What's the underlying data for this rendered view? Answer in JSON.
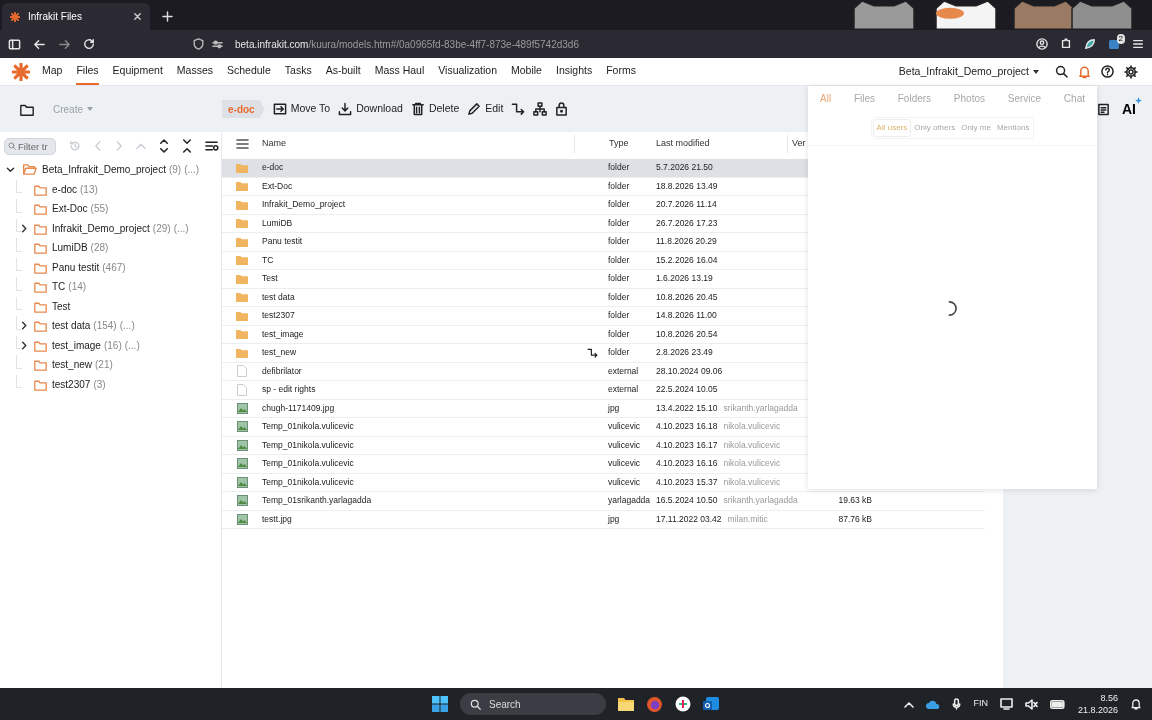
{
  "browser": {
    "tab_title": "Infrakit Files",
    "url_host": "beta.infrakit.com",
    "url_path": "/kuura/models.htm#/0a0965fd-83be-4ff7-873e-489f5742d3d6",
    "extension_badge": "2"
  },
  "nav": {
    "items": [
      {
        "label": "Map",
        "selected": false
      },
      {
        "label": "Files",
        "selected": true
      },
      {
        "label": "Equipment",
        "selected": false
      },
      {
        "label": "Masses",
        "selected": false
      },
      {
        "label": "Schedule",
        "selected": false
      },
      {
        "label": "Tasks",
        "selected": false
      },
      {
        "label": "As-built",
        "selected": false
      },
      {
        "label": "Mass Haul",
        "selected": false
      },
      {
        "label": "Visualization",
        "selected": false
      },
      {
        "label": "Mobile",
        "selected": false
      },
      {
        "label": "Insights",
        "selected": false
      },
      {
        "label": "Forms",
        "selected": false
      }
    ],
    "project": "Beta_Infrakit_Demo_project",
    "notifications_active": true
  },
  "toolbar": {
    "create": {
      "label": "Create",
      "disabled": true
    },
    "breadcrumb": "e-doc",
    "actions": [
      {
        "kind": "move",
        "label": "Move To"
      },
      {
        "kind": "download",
        "label": "Download"
      },
      {
        "kind": "delete",
        "label": "Delete"
      },
      {
        "kind": "edit",
        "label": "Edit"
      }
    ],
    "ai_label": "AI"
  },
  "tree": {
    "filter_placeholder": "Filter tr",
    "root": {
      "label": "Beta_Infrakit_Demo_project",
      "count": "(9)",
      "more": "(...)",
      "expanded": true,
      "children": [
        {
          "label": "e-doc",
          "count": "(13)",
          "expandable": false
        },
        {
          "label": "Ext-Doc",
          "count": "(55)",
          "expandable": false
        },
        {
          "label": "Infrakit_Demo_project",
          "count": "(29)",
          "more": "(...)",
          "expandable": true
        },
        {
          "label": "LumiDB",
          "count": "(28)",
          "expandable": false
        },
        {
          "label": "Panu testit",
          "count": "(467)",
          "expandable": false
        },
        {
          "label": "TC",
          "count": "(14)",
          "expandable": false
        },
        {
          "label": "Test",
          "expandable": false
        },
        {
          "label": "test data",
          "count": "(154)",
          "more": "(...)",
          "expandable": true
        },
        {
          "label": "test_image",
          "count": "(16)",
          "more": "(...)",
          "expandable": true
        },
        {
          "label": "test_new",
          "count": "(21)",
          "expandable": false
        },
        {
          "label": "test2307",
          "count": "(3)",
          "expandable": false
        }
      ]
    }
  },
  "table": {
    "columns": [
      "Name",
      "Type",
      "Last modified",
      "Ver"
    ],
    "rows": [
      {
        "kind": "folder",
        "name": "e-doc",
        "type": "folder",
        "modified": "5.7.2026 21.50",
        "selected": true,
        "shortcut": false
      },
      {
        "kind": "folder",
        "name": "Ext-Doc",
        "type": "folder",
        "modified": "18.8.2026 13.49",
        "selected": false,
        "shortcut": false
      },
      {
        "kind": "folder",
        "name": "Infrakit_Demo_project",
        "type": "folder",
        "modified": "20.7.2026 11.14",
        "selected": false,
        "shortcut": false
      },
      {
        "kind": "folder",
        "name": "LumiDB",
        "type": "folder",
        "modified": "26.7.2026 17.23",
        "selected": false,
        "shortcut": false
      },
      {
        "kind": "folder",
        "name": "Panu testit",
        "type": "folder",
        "modified": "11.8.2026 20.29",
        "selected": false,
        "shortcut": false
      },
      {
        "kind": "folder",
        "name": "TC",
        "type": "folder",
        "modified": "15.2.2026 16.04",
        "selected": false,
        "shortcut": false
      },
      {
        "kind": "folder",
        "name": "Test",
        "type": "folder",
        "modified": "1.6.2026 13.19",
        "selected": false,
        "shortcut": false
      },
      {
        "kind": "folder",
        "name": "test data",
        "type": "folder",
        "modified": "10.8.2026 20.45",
        "selected": false,
        "shortcut": false
      },
      {
        "kind": "folder",
        "name": "test2307",
        "type": "folder",
        "modified": "14.8.2026 11.00",
        "selected": false,
        "shortcut": false
      },
      {
        "kind": "folder",
        "name": "test_image",
        "type": "folder",
        "modified": "10.8.2026 20.54",
        "selected": false,
        "shortcut": false
      },
      {
        "kind": "folder",
        "name": "test_new",
        "type": "folder",
        "modified": "2.8.2026 23.49",
        "selected": false,
        "shortcut": true
      },
      {
        "kind": "file",
        "name": "defibrilator",
        "type": "external",
        "modified": "28.10.2024 09.06",
        "selected": false,
        "shortcut": false
      },
      {
        "kind": "file",
        "name": "sp - edit rights",
        "type": "external",
        "modified": "22.5.2024 10.05",
        "selected": false,
        "shortcut": false
      },
      {
        "kind": "image",
        "name": "chugh-1171409.jpg",
        "type": "jpg",
        "modified": "13.4.2022 15.10",
        "user": "srikanth.yarlagadda",
        "selected": false,
        "shortcut": false
      },
      {
        "kind": "image",
        "name": "Temp_01nikola.vulicevic",
        "type": "vulicevic",
        "modified": "4.10.2023 16.18",
        "user": "nikola.vulicevic",
        "selected": false,
        "shortcut": false
      },
      {
        "kind": "image",
        "name": "Temp_01nikola.vulicevic",
        "type": "vulicevic",
        "modified": "4.10.2023 16.17",
        "user": "nikola.vulicevic",
        "selected": false,
        "shortcut": false
      },
      {
        "kind": "image",
        "name": "Temp_01nikola.vulicevic",
        "type": "vulicevic",
        "modified": "4.10.2023 16.16",
        "user": "nikola.vulicevic",
        "selected": false,
        "shortcut": false
      },
      {
        "kind": "image",
        "name": "Temp_01nikola.vulicevic",
        "type": "vulicevic",
        "modified": "4.10.2023 15.37",
        "user": "nikola.vulicevic",
        "selected": false,
        "shortcut": false
      },
      {
        "kind": "image",
        "name": "Temp_01srikanth.yarlagadda",
        "type": "yarlagadda",
        "modified": "16.5.2024 10.50",
        "user": "srikanth.yarlagadda",
        "size": "19.63 kB",
        "selected": false,
        "shortcut": false
      },
      {
        "kind": "image",
        "name": "testt.jpg",
        "type": "jpg",
        "modified": "17.11.2022 03.42",
        "user": "milan.mitic",
        "size": "87.76 kB",
        "selected": false,
        "shortcut": false
      }
    ]
  },
  "notifications": {
    "tabs": [
      {
        "label": "All",
        "selected": true
      },
      {
        "label": "Files",
        "selected": false
      },
      {
        "label": "Folders",
        "selected": false
      },
      {
        "label": "Photos",
        "selected": false
      },
      {
        "label": "Service",
        "selected": false
      },
      {
        "label": "Chat",
        "selected": false
      }
    ],
    "filters": [
      {
        "label": "All users",
        "selected": true
      },
      {
        "label": "Only others",
        "selected": false
      },
      {
        "label": "Only me",
        "selected": false
      },
      {
        "label": "Mentions",
        "selected": false
      }
    ],
    "loading": true
  },
  "taskbar": {
    "search_placeholder": "Search",
    "language": "FIN",
    "time": "8.56",
    "date": "21.8.2026"
  }
}
